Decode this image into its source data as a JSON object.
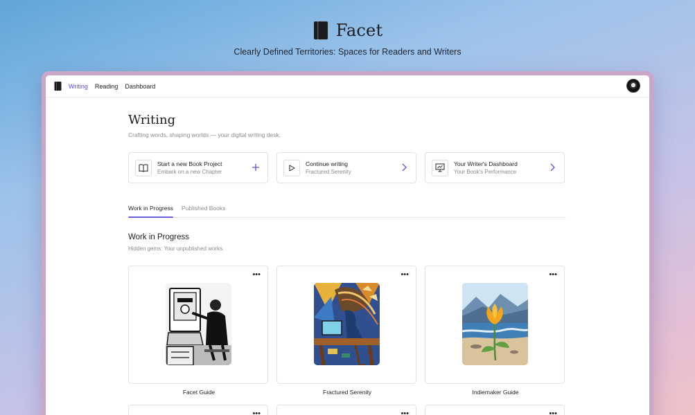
{
  "hero": {
    "brand": "Facet",
    "tagline": "Clearly Defined Territories: Spaces for Readers and Writers"
  },
  "nav": {
    "items": [
      {
        "label": "Writing",
        "active": true
      },
      {
        "label": "Reading",
        "active": false
      },
      {
        "label": "Dashboard",
        "active": false
      }
    ]
  },
  "page": {
    "title": "Writing",
    "subtitle": "Crafting words, shaping worlds — your digital writing desk."
  },
  "actions": [
    {
      "title": "Start a new Book Project",
      "subtitle": "Embark on a new Chapter",
      "icon": "open-book-icon",
      "trailing": "plus-icon"
    },
    {
      "title": "Continue writing",
      "subtitle": "Fractured Serenity",
      "icon": "play-icon",
      "trailing": "chevron-right-icon"
    },
    {
      "title": "Your Writer's Dashboard",
      "subtitle": "Your Book's Performance",
      "icon": "presentation-chart-icon",
      "trailing": "chevron-right-icon"
    }
  ],
  "tabs": [
    {
      "label": "Work in Progress",
      "active": true
    },
    {
      "label": "Published Books",
      "active": false
    }
  ],
  "section": {
    "title": "Work in Progress",
    "subtitle": "Hidden gems: Your unpublished works."
  },
  "books": [
    {
      "title": "Facet Guide",
      "menu": "•••"
    },
    {
      "title": "Fractured Serenity",
      "menu": "•••"
    },
    {
      "title": "Indiemaker Guide",
      "menu": "•••"
    }
  ],
  "more_menu": "•••",
  "colors": {
    "accent": "#5b4fd6"
  }
}
